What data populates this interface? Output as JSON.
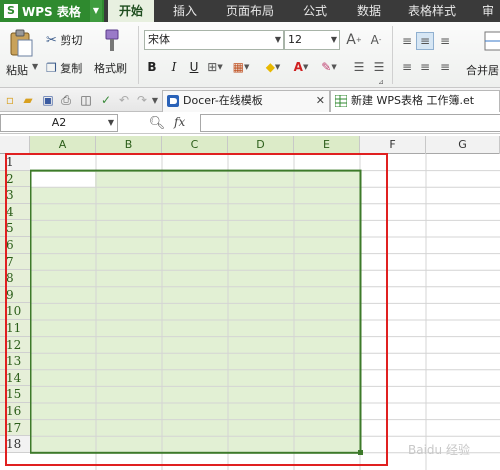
{
  "app": {
    "logo": "S",
    "name": "WPS 表格"
  },
  "menu": [
    "开始",
    "插入",
    "页面布局",
    "公式",
    "数据",
    "表格样式",
    "审"
  ],
  "ribbon": {
    "paste": "粘贴",
    "cut": "剪切",
    "copy": "复制",
    "format_painter": "格式刷",
    "font": "宋体",
    "font_size": "12",
    "bold": "B",
    "italic": "I",
    "underline": "U",
    "merge": "合并居"
  },
  "tabs": [
    {
      "label": "Docer-在线模板"
    },
    {
      "label": "新建 WPS表格 工作簿.et"
    }
  ],
  "formula_bar": {
    "cell_ref": "A2",
    "fx": "fx",
    "zoom_icon": "magnifier-icon"
  },
  "columns": [
    "A",
    "B",
    "C",
    "D",
    "E",
    "F",
    "G"
  ],
  "rows": [
    "1",
    "2",
    "3",
    "4",
    "5",
    "6",
    "7",
    "8",
    "9",
    "10",
    "11",
    "12",
    "13",
    "14",
    "15",
    "16",
    "17",
    "18"
  ],
  "selection": {
    "range": "A2:E17"
  },
  "watermark": "Baidu 经验",
  "colors": {
    "menubar": "#3a3a3a",
    "app_green": "#2f8a2f",
    "selection_fill": "#e2f0d4",
    "selection_border": "#3d7a2a",
    "highlight_box": "#e02020"
  }
}
